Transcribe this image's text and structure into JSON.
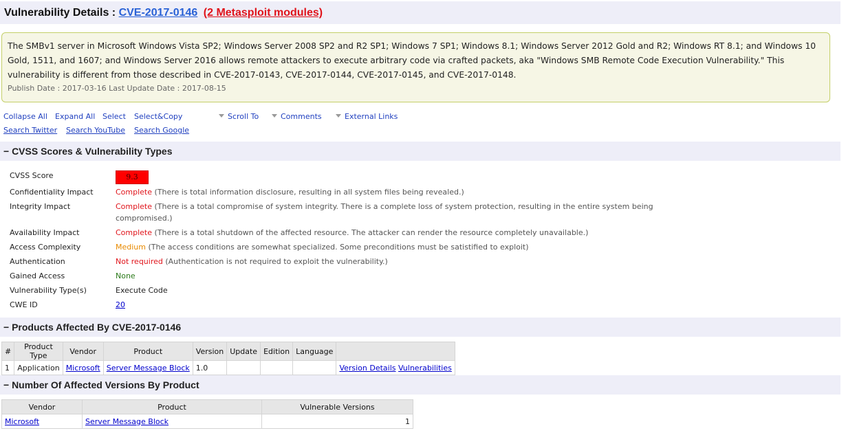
{
  "header": {
    "title": "Vulnerability Details : ",
    "cve_link": "CVE-2017-0146",
    "metasploit_link": "(2 Metasploit modules)"
  },
  "summary": {
    "description": "The SMBv1 server in Microsoft Windows Vista SP2; Windows Server 2008 SP2 and R2 SP1; Windows 7 SP1; Windows 8.1; Windows Server 2012 Gold and R2; Windows RT 8.1; and Windows 10 Gold, 1511, and 1607; and Windows Server 2016 allows remote attackers to execute arbitrary code via crafted packets, aka \"Windows SMB Remote Code Execution Vulnerability.\" This vulnerability is different from those described in CVE-2017-0143, CVE-2017-0144, CVE-2017-0145, and CVE-2017-0148.",
    "dates": "Publish Date : 2017-03-16 Last Update Date : 2017-08-15"
  },
  "toolbar": {
    "collapse_all": "Collapse All",
    "expand_all": "Expand All",
    "select": "Select",
    "select_copy": "Select&Copy",
    "scroll_to": "Scroll To",
    "comments": "Comments",
    "external_links": "External Links",
    "search_twitter": "Search Twitter",
    "search_youtube": "Search YouTube",
    "search_google": "Search Google"
  },
  "cvss": {
    "heading": "− CVSS Scores & Vulnerability Types",
    "score_label": "CVSS Score",
    "score": "9.3",
    "confidentiality_label": "Confidentiality Impact",
    "confidentiality_value": "Complete",
    "confidentiality_desc": " (There is total information disclosure, resulting in all system files being revealed.)",
    "integrity_label": "Integrity Impact",
    "integrity_value": "Complete",
    "integrity_desc": " (There is a total compromise of system integrity. There is a complete loss of system protection, resulting in the entire system being compromised.)",
    "availability_label": "Availability Impact",
    "availability_value": "Complete",
    "availability_desc": " (There is a total shutdown of the affected resource. The attacker can render the resource completely unavailable.)",
    "complexity_label": "Access Complexity",
    "complexity_value": "Medium",
    "complexity_desc": " (The access conditions are somewhat specialized. Some preconditions must be satistified to exploit)",
    "authentication_label": "Authentication",
    "authentication_value": "Not required",
    "authentication_desc": " (Authentication is not required to exploit the vulnerability.)",
    "gained_label": "Gained Access",
    "gained_value": "None",
    "vtype_label": "Vulnerability Type(s)",
    "vtype_value": "Execute Code",
    "cwe_label": "CWE ID",
    "cwe_value": "20"
  },
  "products": {
    "heading": "− Products Affected By CVE-2017-0146",
    "headers": [
      "#",
      "Product Type",
      "Vendor",
      "Product",
      "Version",
      "Update",
      "Edition",
      "Language"
    ],
    "row": {
      "num": "1",
      "type": "Application",
      "vendor": "Microsoft",
      "product": "Server Message Block",
      "version": "1.0",
      "update": "",
      "edition": "",
      "language": "",
      "version_details": "Version Details",
      "vulnerabilities": "Vulnerabilities"
    }
  },
  "versions": {
    "heading": "− Number Of Affected Versions By Product",
    "headers": [
      "Vendor",
      "Product",
      "Vulnerable Versions"
    ],
    "row": {
      "vendor": "Microsoft",
      "product": "Server Message Block",
      "count": "1"
    }
  },
  "colors": {
    "header_bg": "#eeeef8",
    "summary_bg": "#f6f6e5",
    "summary_border": "#c4cf68",
    "score_bg": "#ff0000",
    "complete": "#e0141b",
    "medium": "#e88a00",
    "none": "#2b7a1a",
    "link": "#1f3fbf"
  }
}
